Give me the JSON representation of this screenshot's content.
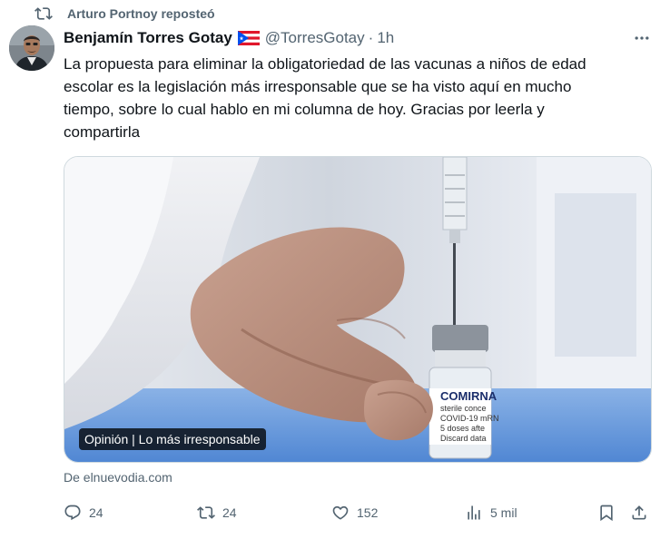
{
  "repost_banner": {
    "text": "Arturo Portnoy reposteó",
    "icon": "repost-icon"
  },
  "author": {
    "name": "Benjamín Torres Gotay",
    "flag": "puerto-rico-flag",
    "handle": "@TorresGotay",
    "separator": "·",
    "time": "1h"
  },
  "tweet": {
    "text": "La propuesta para eliminar la obligatoriedad de las vacunas a niños de edad\nescolar es la legislación más irresponsable que se ha visto aquí en mucho\ntiempo, sobre lo cual hablo en mi columna de hoy. Gracias por leerla y\ncompartirla"
  },
  "card": {
    "label": "Opinión | Lo más irresponsable",
    "vial_text": [
      "COMIRNA",
      "sterile conce",
      "COVID-19 mRN",
      "5 doses afte",
      "Discard data"
    ]
  },
  "source": "De elnuevodia.com",
  "actions": {
    "replies": "24",
    "reposts": "24",
    "likes": "152",
    "views": "5 mil"
  },
  "colors": {
    "text": "#0f1419",
    "secondary": "#536471",
    "border": "#cfd9de"
  }
}
